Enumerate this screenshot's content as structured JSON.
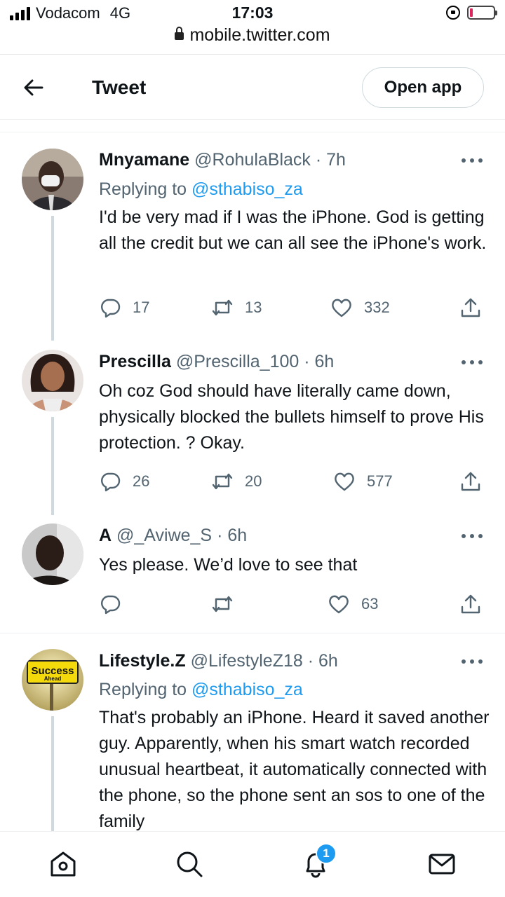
{
  "status_bar": {
    "carrier": "Vodacom",
    "network": "4G",
    "time": "17:03",
    "url": "mobile.twitter.com",
    "battery_color": "#e0245e"
  },
  "header": {
    "back_icon": "arrow-left-icon",
    "title": "Tweet",
    "open_app_label": "Open app"
  },
  "tweets": [
    {
      "name": "Mnyamane",
      "handle": "@RohulaBlack",
      "dot": "·",
      "time": "7h",
      "replying_prefix": "Replying to",
      "replying_to": "@sthabiso_za",
      "text": "I'd be very mad if I was the iPhone. God is getting all the credit but we can all see the iPhone's work.",
      "replies": "17",
      "retweets": "13",
      "likes": "332"
    },
    {
      "name": "Prescilla",
      "handle": "@Prescilla_100",
      "dot": "·",
      "time": "6h",
      "text": "Oh coz God should have literally came down, physically blocked the bullets himself to prove His protection. ? Okay.",
      "replies": "26",
      "retweets": "20",
      "likes": "577"
    },
    {
      "name": "A",
      "handle": "@_Aviwe_S",
      "dot": "·",
      "time": "6h",
      "text": "Yes please. We’d love to see that",
      "replies": "",
      "retweets": "",
      "likes": "63"
    },
    {
      "name": "Lifestyle.Z",
      "handle": "@LifestyleZ18",
      "dot": "·",
      "time": "6h",
      "replying_prefix": "Replying to",
      "replying_to": "@sthabiso_za",
      "text": "That's probably an iPhone. Heard it saved another guy. Apparently, when his smart watch recorded unusual heartbeat, it automatically connected with the phone, so the phone sent an sos to one of the family",
      "avatar_sign_text": "Success",
      "avatar_sign_sub": "Ahead"
    }
  ],
  "bottom_nav": {
    "items": [
      "home-icon",
      "search-icon",
      "notifications-icon",
      "messages-icon"
    ],
    "notification_count": "1",
    "accent": "#1d9bf0"
  }
}
